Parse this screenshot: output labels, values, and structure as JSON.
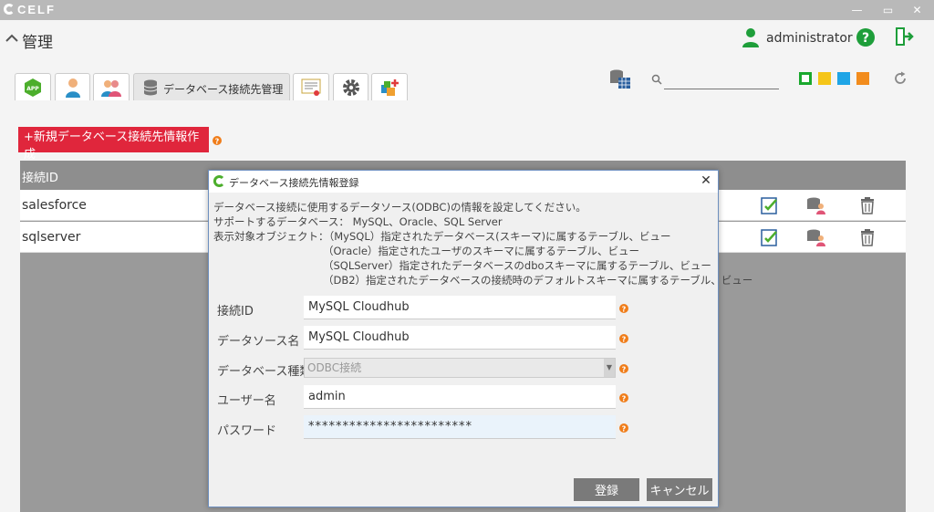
{
  "window": {
    "logo": "CELF",
    "min_label": "—",
    "max_label": "▭",
    "close_label": "✕"
  },
  "header": {
    "title": "管理",
    "username": "administrator"
  },
  "tabs": {
    "active_label": "データベース接続先管理"
  },
  "toolbar": {
    "search_value": "",
    "swatches": [
      "#1aa82e",
      "#f5c518",
      "#1fa5e6",
      "#f28c1d"
    ]
  },
  "main": {
    "new_button_label": "+新規データベース接続先情報作成",
    "column_header": "接続ID",
    "rows": [
      {
        "name": "salesforce"
      },
      {
        "name": "sqlserver"
      }
    ]
  },
  "dialog": {
    "title": "データベース接続先情報登録",
    "close_label": "✕",
    "desc": [
      "データベース接続に使用するデータソース(ODBC)の情報を設定してください。",
      "サポートするデータベース： MySQL、Oracle、SQL Server",
      "表示対象オブジェクト：（MySQL）指定されたデータベース(スキーマ)に属するテーブル、ビュー",
      "（Oracle）指定されたユーザのスキーマに属するテーブル、ビュー",
      "（SQLServer）指定されたデータベースのdboスキーマに属するテーブル、ビュー",
      "（DB2）指定されたデータベースの接続時のデフォルトスキーマに属するテーブル、ビュー"
    ],
    "fields": {
      "conn_id_label": "接続ID",
      "conn_id_value": "MySQL Cloudhub",
      "dsn_label": "データソース名",
      "dsn_value": "MySQL Cloudhub",
      "dbtype_label": "データベース種類",
      "dbtype_value": "ODBC接続",
      "user_label": "ユーザー名",
      "user_value": "admin",
      "password_label": "パスワード",
      "password_value": "************************"
    },
    "register_label": "登録",
    "cancel_label": "キャンセル"
  }
}
